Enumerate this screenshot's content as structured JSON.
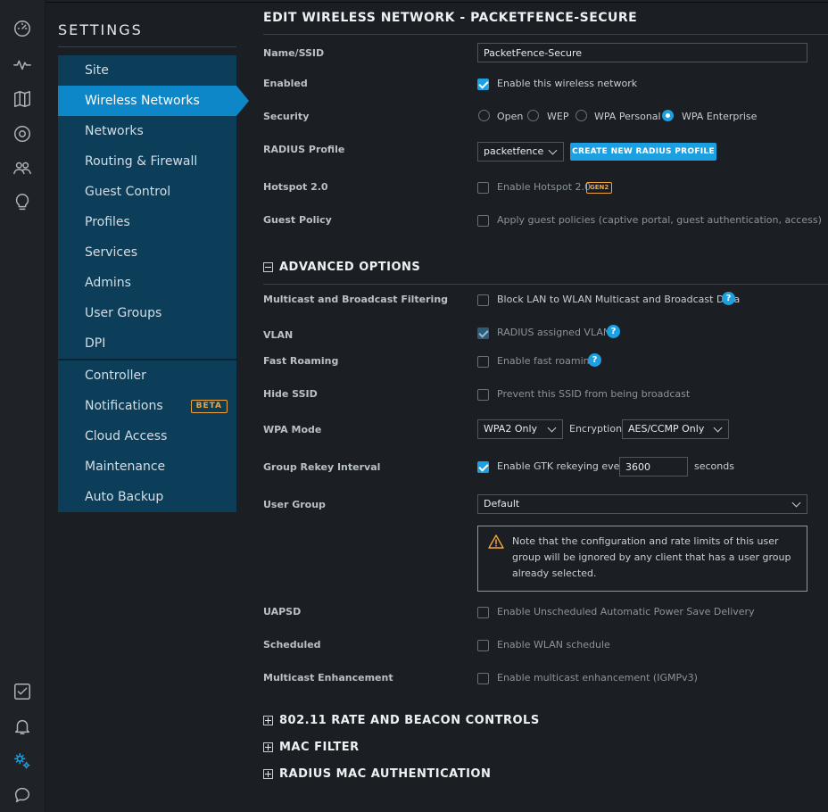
{
  "colors": {
    "accent": "#1da0e2",
    "menu_bg": "#0c3e5a",
    "menu_active": "#0d87c7",
    "badge": "#f3a43a"
  },
  "rail": {
    "icons": [
      "dashboard-icon",
      "statistics-icon",
      "map-icon",
      "devices-icon",
      "clients-icon",
      "insights-icon",
      "alerts-checklist-icon",
      "events-bell-icon",
      "settings-gear-icon",
      "chat-support-icon"
    ]
  },
  "settings": {
    "title": "SETTINGS",
    "items": [
      {
        "label": "Site"
      },
      {
        "label": "Wireless Networks"
      },
      {
        "label": "Networks"
      },
      {
        "label": "Routing & Firewall"
      },
      {
        "label": "Guest Control"
      },
      {
        "label": "Profiles"
      },
      {
        "label": "Services"
      },
      {
        "label": "Admins"
      },
      {
        "label": "User Groups"
      },
      {
        "label": "DPI"
      },
      {
        "label": "Controller"
      },
      {
        "label": "Notifications",
        "badge": "BETA"
      },
      {
        "label": "Cloud Access"
      },
      {
        "label": "Maintenance"
      },
      {
        "label": "Auto Backup"
      }
    ]
  },
  "form": {
    "title": "EDIT WIRELESS NETWORK - PACKETFENCE-SECURE",
    "ssid": {
      "label": "Name/SSID",
      "value": "PacketFence-Secure"
    },
    "enabled": {
      "label": "Enabled",
      "text": "Enable this wireless network",
      "checked": true
    },
    "security": {
      "label": "Security",
      "options": [
        "Open",
        "WEP",
        "WPA Personal",
        "WPA Enterprise"
      ],
      "selected": "WPA Enterprise"
    },
    "radius": {
      "label": "RADIUS Profile",
      "value": "packetfence",
      "button": "CREATE NEW RADIUS PROFILE"
    },
    "hotspot": {
      "label": "Hotspot 2.0",
      "text": "Enable Hotspot 2.0",
      "badge": "GEN2",
      "checked": false
    },
    "guest": {
      "label": "Guest Policy",
      "text": "Apply guest policies (captive portal, guest authentication, access)",
      "checked": false
    },
    "advanced": {
      "title": "ADVANCED OPTIONS",
      "multicast_filter": {
        "label": "Multicast and Broadcast Filtering",
        "text": "Block LAN to WLAN Multicast and Broadcast Data",
        "checked": false
      },
      "vlan": {
        "label": "VLAN",
        "text": "RADIUS assigned VLAN",
        "checked": true
      },
      "fast_roaming": {
        "label": "Fast Roaming",
        "text": "Enable fast roaming",
        "checked": false
      },
      "hide_ssid": {
        "label": "Hide SSID",
        "text": "Prevent this SSID from being broadcast",
        "checked": false
      },
      "wpa_mode": {
        "label": "WPA Mode",
        "value": "WPA2 Only",
        "encryption_label": "Encryption",
        "encryption_value": "AES/CCMP Only"
      },
      "rekey": {
        "label": "Group Rekey Interval",
        "text": "Enable GTK rekeying every",
        "value": "3600",
        "unit": "seconds",
        "checked": true
      },
      "user_group": {
        "label": "User Group",
        "value": "Default",
        "note": "Note that the configuration and rate limits of this user group will be ignored by any client that has a user group already selected."
      },
      "uapsd": {
        "label": "UAPSD",
        "text": "Enable Unscheduled Automatic Power Save Delivery",
        "checked": false
      },
      "scheduled": {
        "label": "Scheduled",
        "text": "Enable WLAN schedule",
        "checked": false
      },
      "multicast_enh": {
        "label": "Multicast Enhancement",
        "text": "Enable multicast enhancement (IGMPv3)",
        "checked": false
      }
    },
    "sections": [
      "802.11 RATE AND BEACON CONTROLS",
      "MAC FILTER",
      "RADIUS MAC AUTHENTICATION"
    ],
    "help_glyph": "?"
  }
}
